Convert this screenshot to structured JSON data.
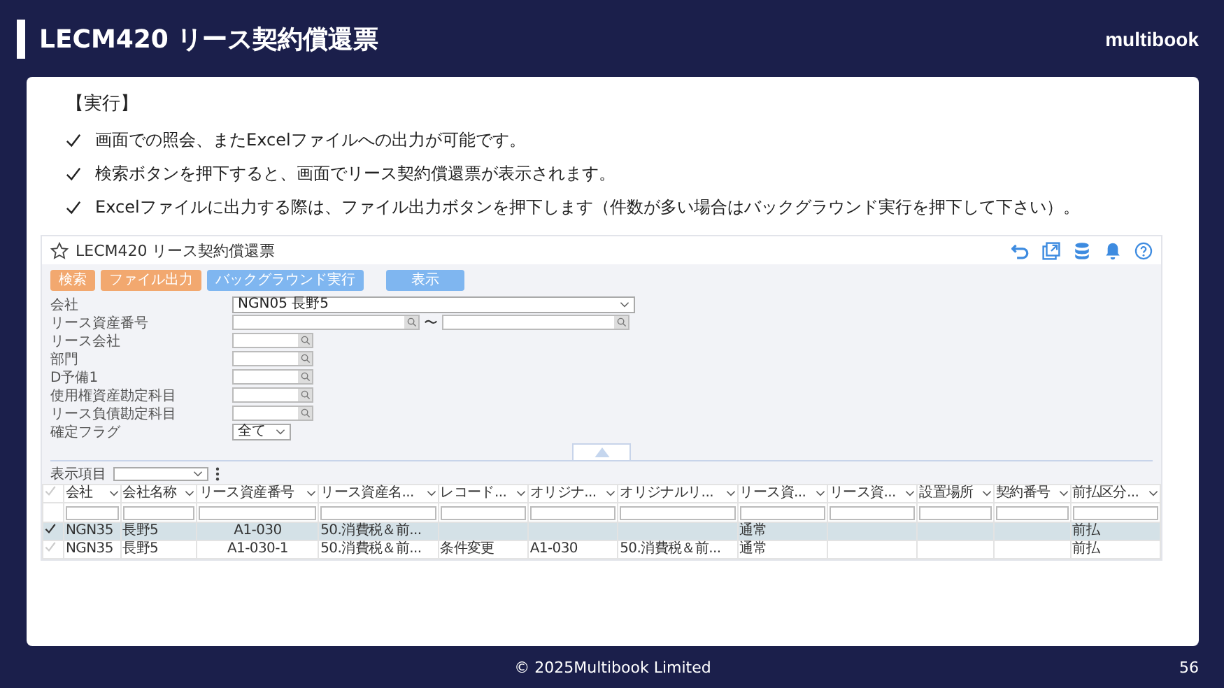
{
  "slide": {
    "title": "LECM420 リース契約償還票",
    "logo": "multibook",
    "footer": "© 2025Multibook Limited",
    "page": "56"
  },
  "section_heading": "【実行】",
  "bullets": [
    "画面での照会、またExcelファイルへの出力が可能です。",
    "検索ボタンを押下すると、画面でリース契約償還票が表示されます。",
    "Excelファイルに出力する際は、ファイル出力ボタンを押下します（件数が多い場合はバックグラウンド実行を押下して下さい）。"
  ],
  "app": {
    "title": "LECM420 リース契約償還票",
    "buttons": [
      {
        "label": "検索",
        "color": "#f2a86f"
      },
      {
        "label": "ファイル出力",
        "color": "#f2a86f"
      },
      {
        "label": "バックグラウンド実行",
        "color": "#7fb6f0"
      },
      {
        "label": "表示",
        "color": "#7fb6f0"
      }
    ],
    "fields": [
      {
        "label": "会社",
        "kind": "select",
        "value": "NGN05 長野5"
      },
      {
        "label": "リース資産番号",
        "kind": "range",
        "separator": "〜"
      },
      {
        "label": "リース会社",
        "kind": "lookup"
      },
      {
        "label": "部門",
        "kind": "lookup"
      },
      {
        "label": "D予備1",
        "kind": "lookup"
      },
      {
        "label": "使用権資産勘定科目",
        "kind": "lookup"
      },
      {
        "label": "リース負債勘定科目",
        "kind": "lookup"
      },
      {
        "label": "確定フラグ",
        "kind": "short_select",
        "value": "全て"
      }
    ],
    "display_label": "表示項目",
    "columns": [
      "会社",
      "会社名称",
      "リース資産番号",
      "リース資産名...",
      "レコード...",
      "オリジナ...",
      "オリジナルリ...",
      "リース資...",
      "リース資...",
      "設置場所",
      "契約番号",
      "前払区分..."
    ],
    "rows": [
      {
        "selected": true,
        "cells": [
          "NGN35",
          "長野5",
          "A1-030",
          "50.消費税＆前...",
          null,
          null,
          null,
          "通常",
          null,
          null,
          null,
          "前払"
        ]
      },
      {
        "selected": false,
        "cells": [
          "NGN35",
          "長野5",
          "A1-030-1",
          "50.消費税＆前...",
          "条件変更",
          "A1-030",
          "50.消費税＆前...",
          "通常",
          null,
          null,
          null,
          "前払"
        ]
      }
    ]
  }
}
